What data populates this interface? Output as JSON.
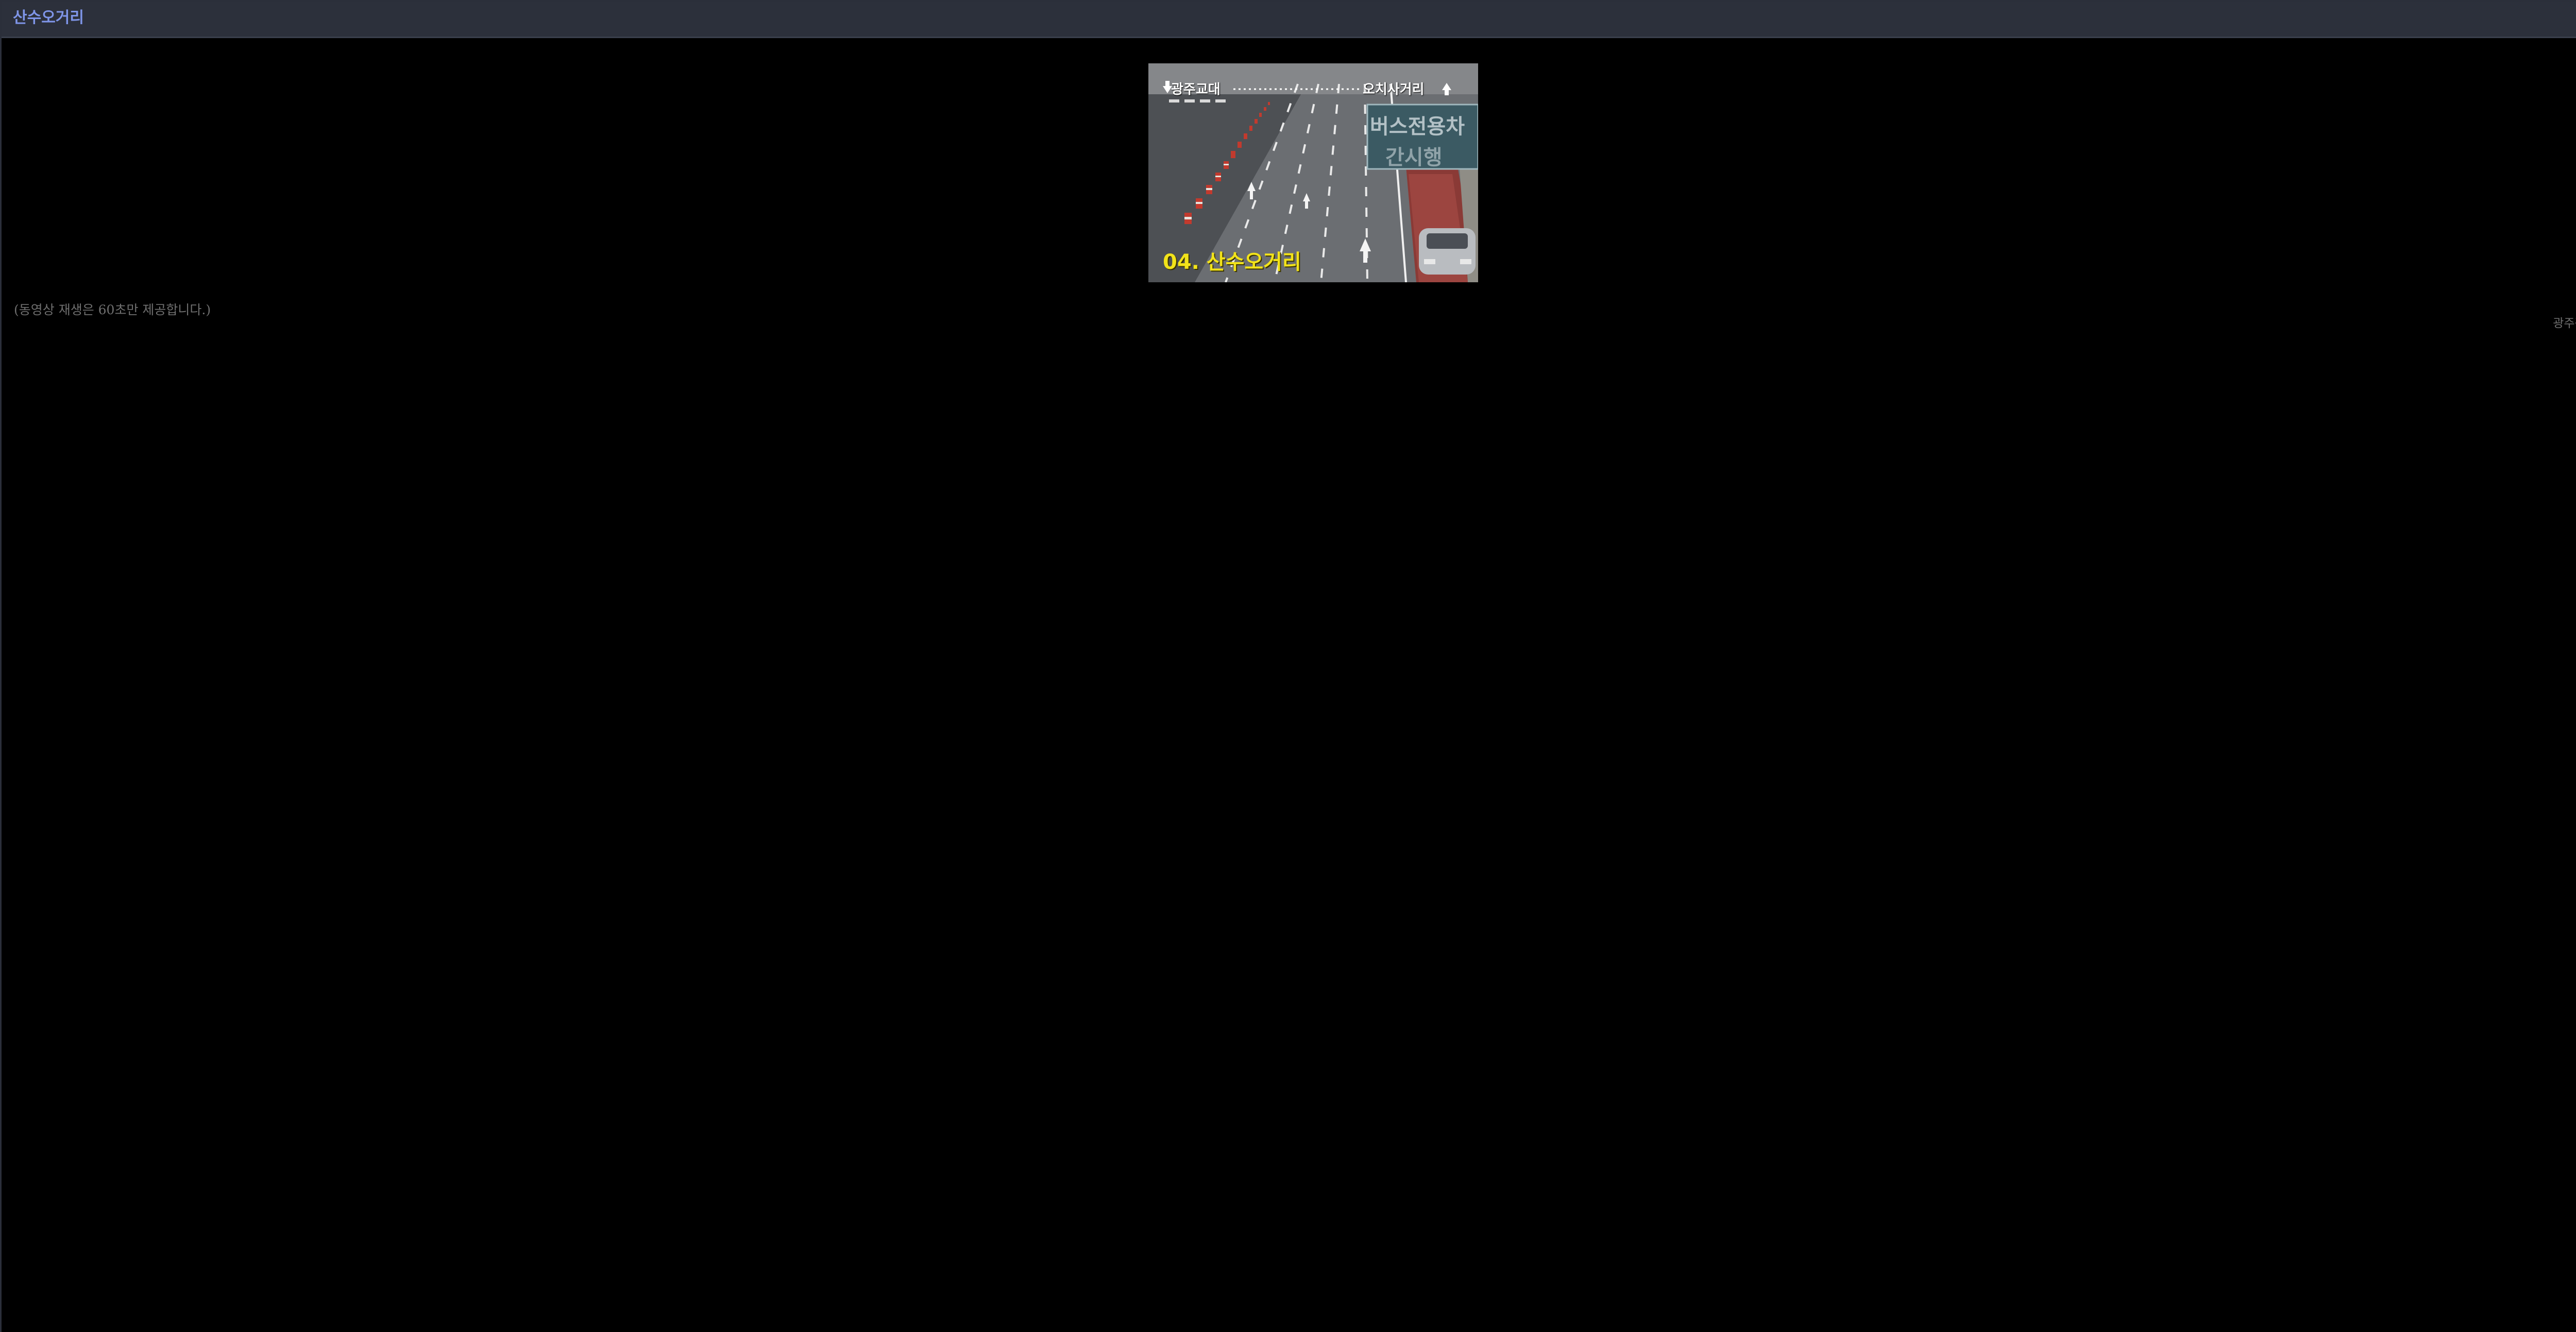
{
  "window": {
    "title": "산수오거리",
    "close_label": "×"
  },
  "video": {
    "camera_label": "04. 산수오거리",
    "direction_left": "광주교대",
    "direction_right": "오치사거리",
    "road_sign_line1": "버스전용차",
    "road_sign_line2": "간시행"
  },
  "notice_text": "(동영상 재생은 60초만 제공합니다.)",
  "credit_text": "광주광역시",
  "colors": {
    "title": "#7f95e8",
    "titlebar": "#2c303b",
    "background": "#000000",
    "camera_label": "#f2e31a",
    "muted_text": "#6f6f6f"
  }
}
